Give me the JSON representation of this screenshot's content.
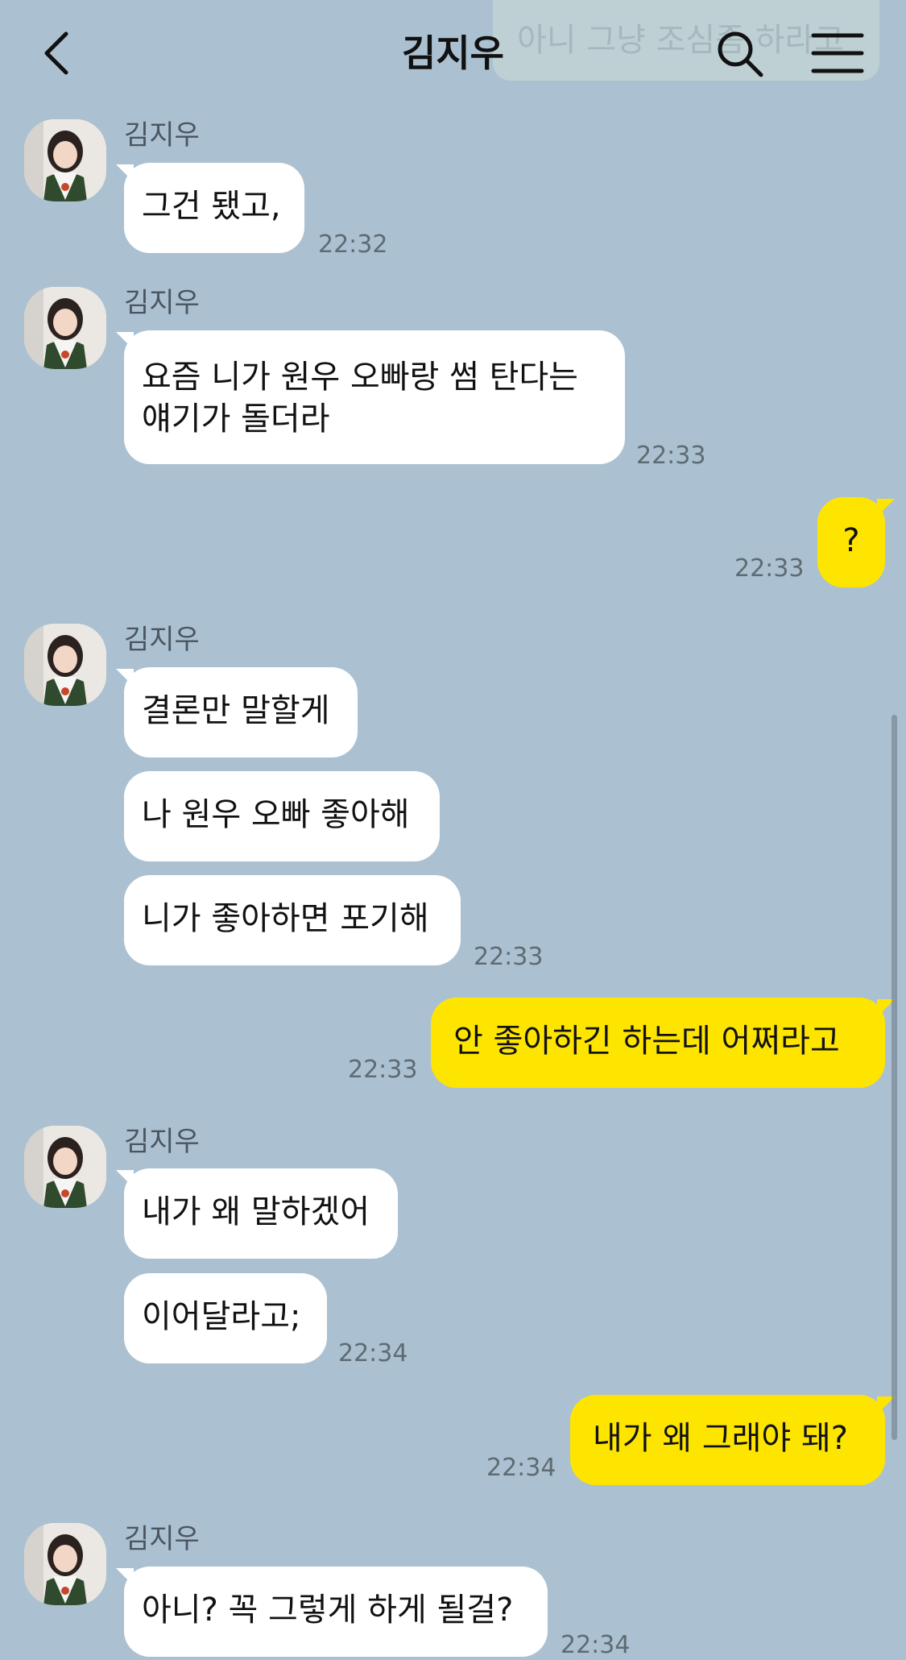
{
  "header": {
    "title": "김지우",
    "ghost_text": "아니 그냥 조심좀 하라고",
    "back_label": "back",
    "search_label": "search",
    "menu_label": "menu"
  },
  "messages": [
    {
      "sender": "김지우",
      "text": "그건 됐고,",
      "time": "22:32"
    },
    {
      "sender": "김지우",
      "text": "요즘 니가 원우 오빠랑 썸 탄다는 얘기가 돌더라",
      "time": "22:33"
    },
    {
      "sender": "me",
      "text": "?",
      "time": "22:33"
    },
    {
      "sender": "김지우",
      "text": "결론만 말할게"
    },
    {
      "sender": "김지우",
      "text": "나 원우 오빠 좋아해"
    },
    {
      "sender": "김지우",
      "text": "니가 좋아하면 포기해",
      "time": "22:33"
    },
    {
      "sender": "me",
      "text": "안 좋아하긴 하는데 어쩌라고",
      "time": "22:33"
    },
    {
      "sender": "김지우",
      "text": "내가 왜 말하겠어"
    },
    {
      "sender": "김지우",
      "text": "이어달라고;",
      "time": "22:34"
    },
    {
      "sender": "me",
      "text": "내가 왜 그래야 돼?",
      "time": "22:34"
    },
    {
      "sender": "김지우",
      "text": "아니? 꼭 그렇게 하게 될걸?",
      "time": "22:34"
    }
  ],
  "colors": {
    "background": "#abc1d1",
    "incoming_bubble": "#ffffff",
    "outgoing_bubble": "#fee500"
  },
  "icons": [
    "chevron-left-icon",
    "search-icon",
    "hamburger-menu-icon"
  ]
}
